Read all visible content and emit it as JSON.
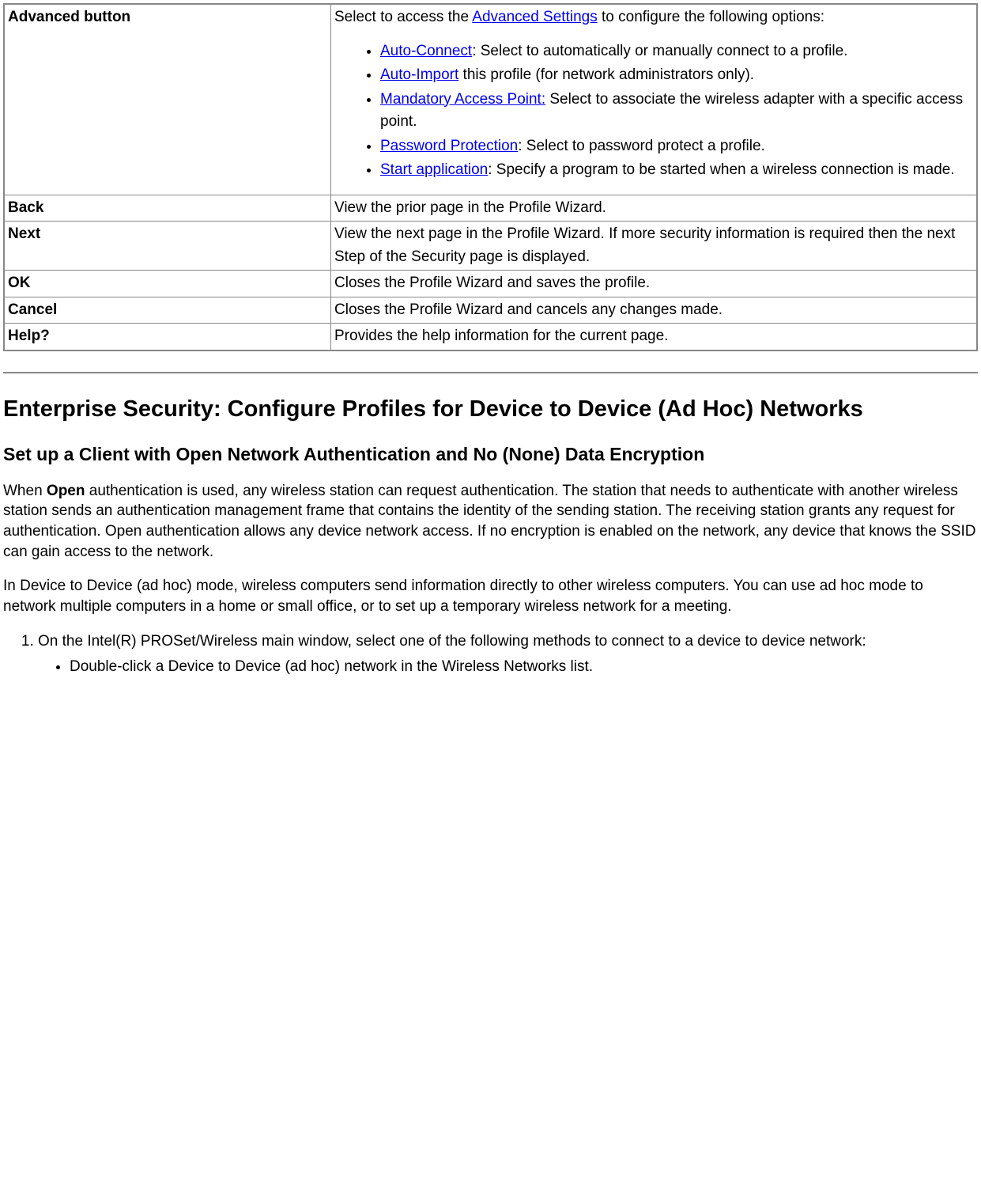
{
  "table": {
    "rows": [
      {
        "name": "Advanced button",
        "desc_prefix": "Select to access the ",
        "desc_link": "Advanced Settings",
        "desc_suffix": " to configure the following options:",
        "items": [
          {
            "link": "Auto-Connect",
            "after": ": Select to automatically or manually connect to a profile."
          },
          {
            "link": "Auto-Import",
            "after": " this profile (for network administrators only)."
          },
          {
            "link": "Mandatory Access Point:",
            "after": " Select to associate the wireless adapter with a specific access point."
          },
          {
            "link": "Password Protection",
            "after": ": Select to password protect a profile."
          },
          {
            "link": "Start application",
            "after": ": Specify a program to be started when a wireless connection is made."
          }
        ]
      },
      {
        "name": "Back",
        "desc": "View the prior page in the Profile Wizard."
      },
      {
        "name": "Next",
        "desc": "View the next page in the Profile Wizard. If more security information is required then the next Step of the Security page is displayed."
      },
      {
        "name": "OK",
        "desc": "Closes the Profile Wizard and saves the profile."
      },
      {
        "name": "Cancel",
        "desc": "Closes the Profile Wizard and cancels any changes made."
      },
      {
        "name": "Help?",
        "desc": "Provides the help information for the current page."
      }
    ]
  },
  "heading2": "Enterprise Security: Configure Profiles for Device to Device (Ad Hoc) Networks",
  "heading3": "Set up a Client with Open Network Authentication and No (None) Data Encryption",
  "para1_prefix": "When ",
  "para1_bold": "Open",
  "para1_suffix": " authentication is used, any wireless station can request authentication. The station that needs to authenticate with another wireless station sends an authentication management frame that contains the identity of the sending station. The receiving station grants any request for authentication. Open authentication allows any device network access. If no encryption is enabled on the network, any device that knows the SSID can gain access to the network.",
  "para2": "In Device to Device (ad hoc) mode, wireless computers send information directly to other wireless computers. You can use ad hoc mode to network multiple computers in a home or small office, or to set up a temporary wireless network for a meeting.",
  "ol": {
    "item1": "On the Intel(R) PROSet/Wireless main window, select one of the following methods to connect to a device to device network:",
    "sub1": "Double-click a Device to Device (ad hoc) network in the Wireless Networks list."
  }
}
